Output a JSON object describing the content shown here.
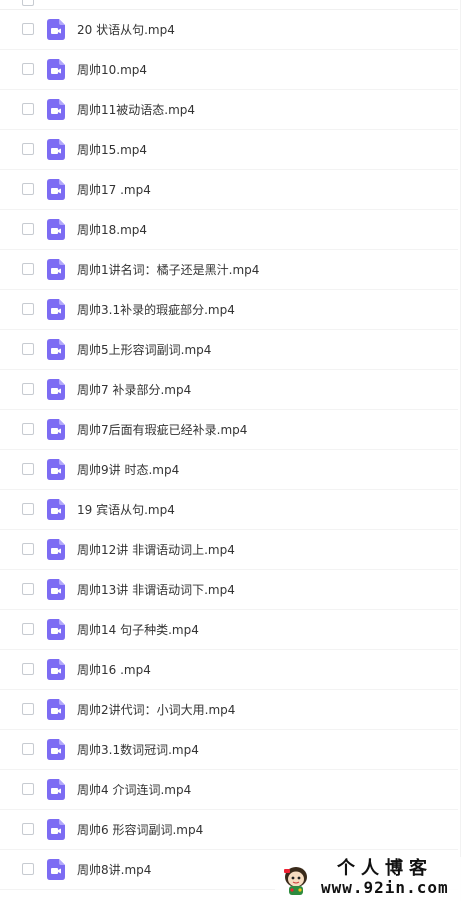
{
  "file_list": {
    "files": [
      {
        "name": "20 状语从句.mp4",
        "type_icon": "video-file-icon"
      },
      {
        "name": "周帅10.mp4",
        "type_icon": "video-file-icon"
      },
      {
        "name": "周帅11被动语态.mp4",
        "type_icon": "video-file-icon"
      },
      {
        "name": "周帅15.mp4",
        "type_icon": "video-file-icon"
      },
      {
        "name": "周帅17 .mp4",
        "type_icon": "video-file-icon"
      },
      {
        "name": "周帅18.mp4",
        "type_icon": "video-file-icon"
      },
      {
        "name": "周帅1讲名词：橘子还是黑汁.mp4",
        "type_icon": "video-file-icon"
      },
      {
        "name": "周帅3.1补录的瑕疵部分.mp4",
        "type_icon": "video-file-icon"
      },
      {
        "name": "周帅5上形容词副词.mp4",
        "type_icon": "video-file-icon"
      },
      {
        "name": "周帅7 补录部分.mp4",
        "type_icon": "video-file-icon"
      },
      {
        "name": "周帅7后面有瑕疵已经补录.mp4",
        "type_icon": "video-file-icon"
      },
      {
        "name": "周帅9讲 时态.mp4",
        "type_icon": "video-file-icon"
      },
      {
        "name": "19 宾语从句.mp4",
        "type_icon": "video-file-icon"
      },
      {
        "name": "周帅12讲 非谓语动词上.mp4",
        "type_icon": "video-file-icon"
      },
      {
        "name": "周帅13讲 非谓语动词下.mp4",
        "type_icon": "video-file-icon"
      },
      {
        "name": "周帅14 句子种类.mp4",
        "type_icon": "video-file-icon"
      },
      {
        "name": "周帅16 .mp4",
        "type_icon": "video-file-icon"
      },
      {
        "name": "周帅2讲代词：小词大用.mp4",
        "type_icon": "video-file-icon"
      },
      {
        "name": "周帅3.1数词冠词.mp4",
        "type_icon": "video-file-icon"
      },
      {
        "name": "周帅4 介词连词.mp4",
        "type_icon": "video-file-icon"
      },
      {
        "name": "周帅6 形容词副词.mp4",
        "type_icon": "video-file-icon"
      },
      {
        "name": "周帅8讲.mp4",
        "type_icon": "video-file-icon"
      }
    ]
  },
  "watermark": {
    "title": "个人博客",
    "url": "www.92in.com"
  },
  "colors": {
    "icon_purple": "#7c6cf3",
    "icon_fold": "#b3a9fb",
    "text": "#333333",
    "checkbox_border": "#c7cbd1",
    "row_divider": "#f3f3f3"
  }
}
